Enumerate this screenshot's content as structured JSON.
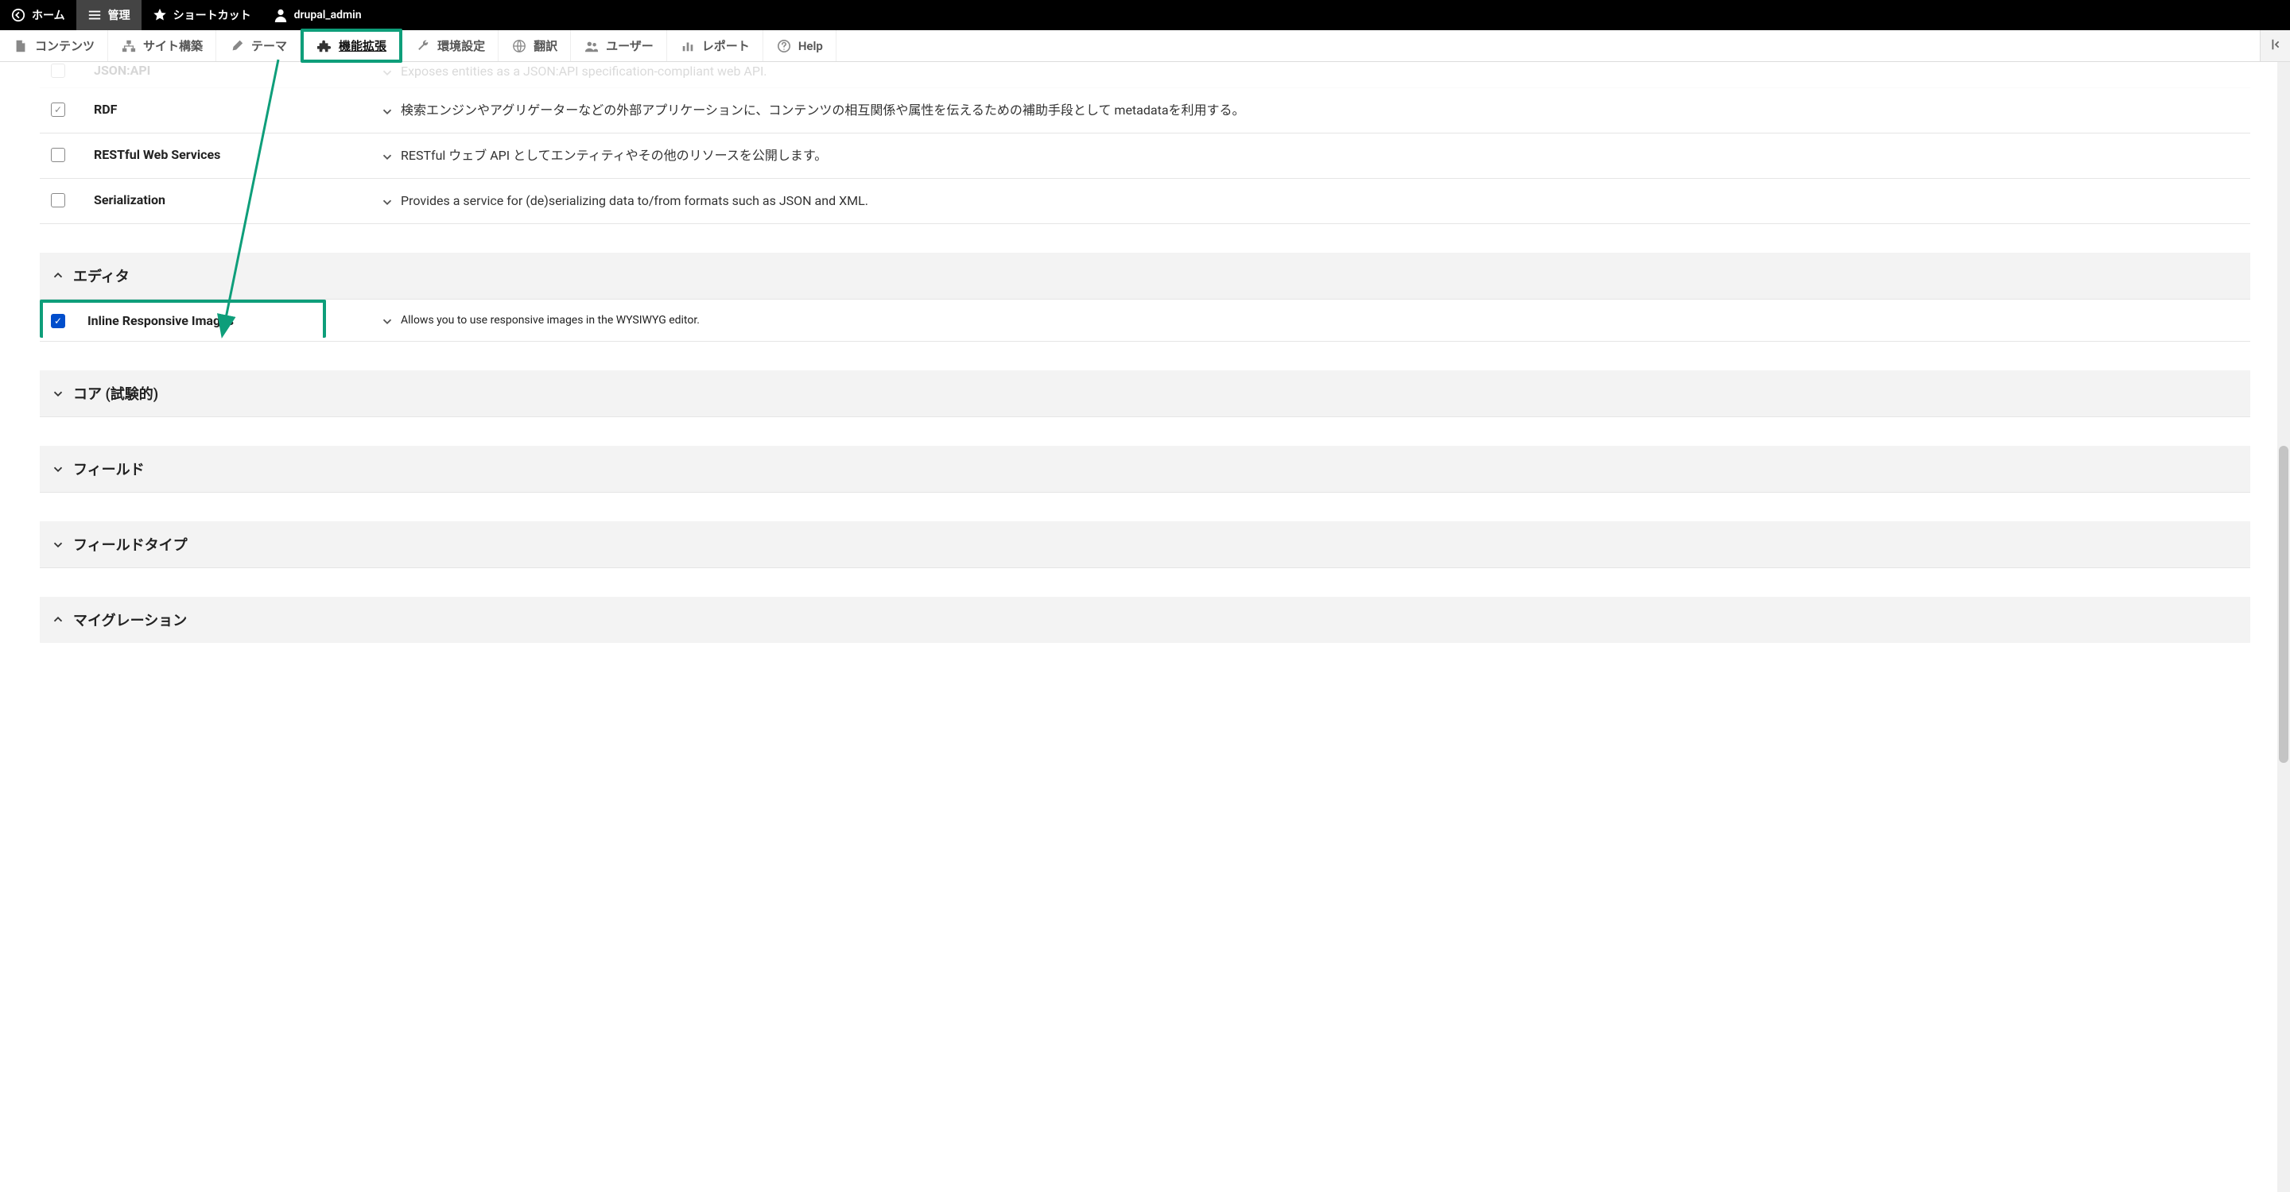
{
  "toolbar": {
    "home": "ホーム",
    "manage": "管理",
    "shortcuts": "ショートカット",
    "user": "drupal_admin"
  },
  "admin_menu": {
    "content": "コンテンツ",
    "structure": "サイト構築",
    "appearance": "テーマ",
    "extend": "機能拡張",
    "config": "環境設定",
    "translate": "翻訳",
    "people": "ユーザー",
    "reports": "レポート",
    "help": "Help"
  },
  "modules": {
    "partial_top": {
      "name": "JSON:API",
      "desc": "Exposes entities as a JSON:API specification-compliant web API.",
      "checked": false
    },
    "rows": [
      {
        "name": "RDF",
        "desc": "検索エンジンやアグリゲーターなどの外部アプリケーションに、コンテンツの相互関係や属性を伝えるための補助手段として metadataを利用する。",
        "checked": true,
        "checked_style": "light"
      },
      {
        "name": "RESTful Web Services",
        "desc": "RESTful ウェブ API としてエンティティやその他のリソースを公開します。",
        "checked": false
      },
      {
        "name": "Serialization",
        "desc": "Provides a service for (de)serializing data to/from formats such as JSON and XML.",
        "checked": false
      }
    ]
  },
  "groups": {
    "editor": {
      "title": "エディタ",
      "open": true
    },
    "core_experimental": {
      "title": "コア (試験的)",
      "open": false
    },
    "field": {
      "title": "フィールド",
      "open": false
    },
    "field_type": {
      "title": "フィールドタイプ",
      "open": false
    },
    "migration": {
      "title": "マイグレーション",
      "open": true
    }
  },
  "editor_module": {
    "name": "Inline Responsive Images",
    "desc": "Allows you to use responsive images in the WYSIWYG editor.",
    "checked": true
  },
  "annotation": {
    "highlight_color": "#0e9e7a"
  }
}
